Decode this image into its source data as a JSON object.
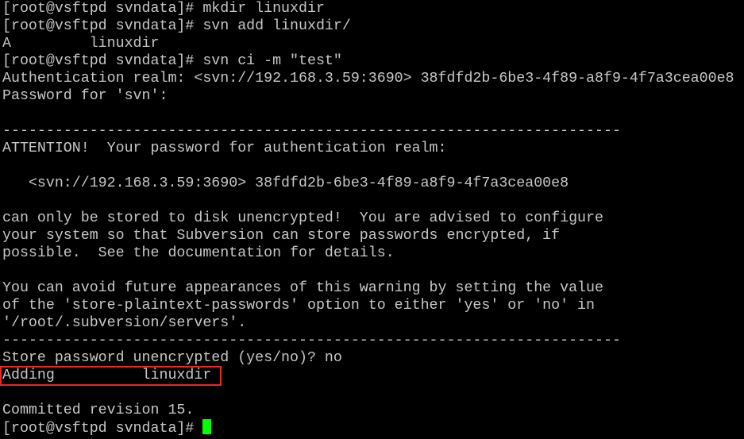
{
  "terminal": {
    "text_color": "#c7c7c7",
    "background_color": "#000000",
    "cursor_color": "#00ff00",
    "highlight_color": "#e8262a",
    "highlight_target": "Adding          linuxdir",
    "lines": [
      "[root@vsftpd svndata]# mkdir linuxdir",
      "[root@vsftpd svndata]# svn add linuxdir/",
      "A         linuxdir",
      "[root@vsftpd svndata]# svn ci -m \"test\"",
      "Authentication realm: <svn://192.168.3.59:3690> 38fdfd2b-6be3-4f89-a8f9-4f7a3cea00e8",
      "Password for 'svn':",
      "",
      "-----------------------------------------------------------------------",
      "ATTENTION!  Your password for authentication realm:",
      "",
      "   <svn://192.168.3.59:3690> 38fdfd2b-6be3-4f89-a8f9-4f7a3cea00e8",
      "",
      "can only be stored to disk unencrypted!  You are advised to configure",
      "your system so that Subversion can store passwords encrypted, if",
      "possible.  See the documentation for details.",
      "",
      "You can avoid future appearances of this warning by setting the value",
      "of the 'store-plaintext-passwords' option to either 'yes' or 'no' in",
      "'/root/.subversion/servers'.",
      "-----------------------------------------------------------------------",
      "Store password unencrypted (yes/no)? no",
      "Adding          linuxdir",
      "",
      "Committed revision 15.",
      "[root@vsftpd svndata]# "
    ]
  }
}
